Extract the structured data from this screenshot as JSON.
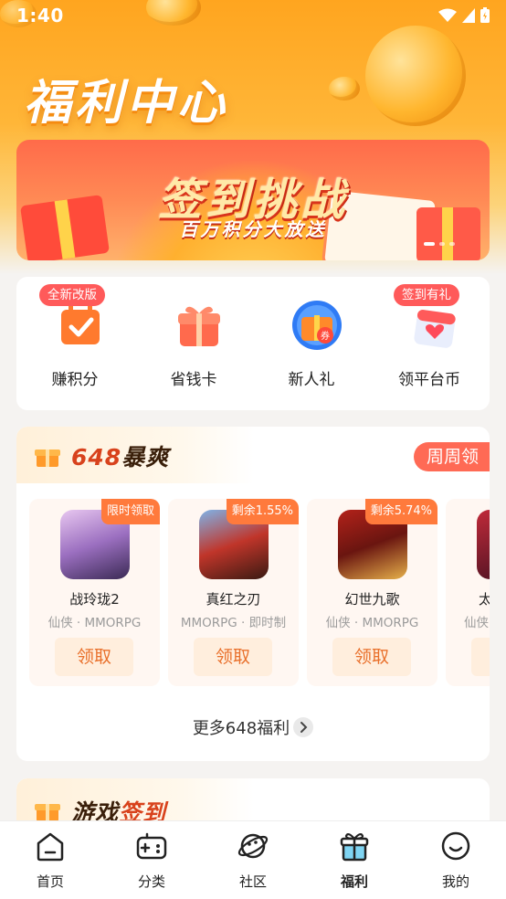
{
  "status": {
    "time": "1:40"
  },
  "header": {
    "title": "福利中心"
  },
  "banner": {
    "title": "签到挑战",
    "subtitle": "百万积分大放送"
  },
  "quick_actions": [
    {
      "label": "赚积分",
      "tag": "全新改版",
      "icon": "calendar-check-icon"
    },
    {
      "label": "省钱卡",
      "tag": "",
      "icon": "gift-box-icon"
    },
    {
      "label": "新人礼",
      "tag": "",
      "icon": "coupon-gift-icon"
    },
    {
      "label": "领平台币",
      "tag": "签到有礼",
      "icon": "calendar-heart-icon"
    }
  ],
  "section_648": {
    "title_num": "648",
    "title_text": "暴爽",
    "weekly_label": "周周领",
    "games": [
      {
        "name": "战玲珑2",
        "genre": "仙侠 · MMORPG",
        "tag": "限时领取",
        "button": "领取"
      },
      {
        "name": "真红之刃",
        "genre": "MMORPG · 即时制",
        "tag": "剩余1.55%",
        "button": "领取"
      },
      {
        "name": "幻世九歌",
        "genre": "仙侠 · MMORPG",
        "tag": "剩余5.74%",
        "button": "领取"
      },
      {
        "name": "太",
        "genre": "仙侠",
        "tag": "",
        "button": "领取"
      }
    ],
    "more_label": "更多648福利"
  },
  "section_sign": {
    "title_a": "游戏",
    "title_b": "签到"
  },
  "tabbar": [
    {
      "label": "首页",
      "icon": "home-icon"
    },
    {
      "label": "分类",
      "icon": "gamepad-icon"
    },
    {
      "label": "社区",
      "icon": "planet-icon"
    },
    {
      "label": "福利",
      "icon": "gift-icon",
      "active": true
    },
    {
      "label": "我的",
      "icon": "smile-face-icon"
    }
  ],
  "colors": {
    "accent": "#ff6a55",
    "orange": "#ffa51f",
    "claim_text": "#e9702b"
  }
}
